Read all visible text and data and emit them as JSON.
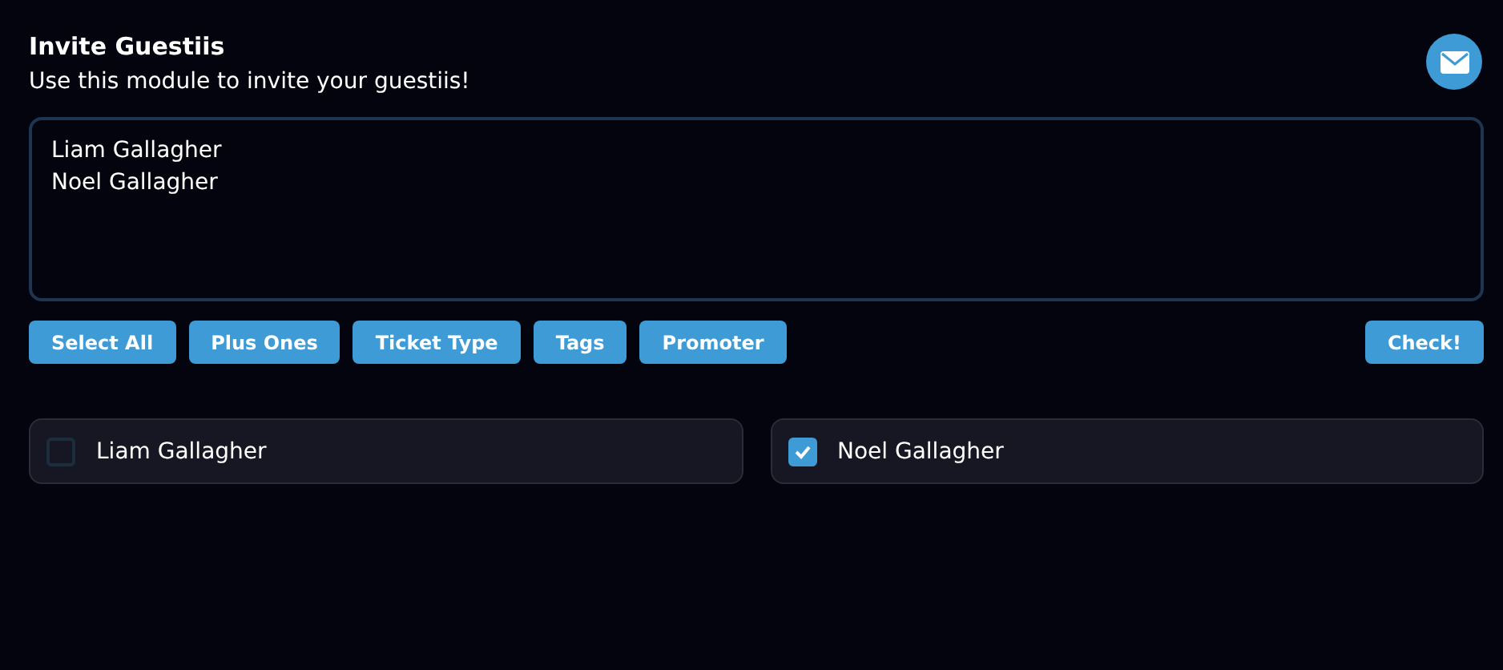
{
  "title": "Invite Guestiis",
  "subtitle": "Use this module to invite your guestiis!",
  "guest_field": {
    "lines": [
      "Liam Gallagher",
      "Noel Gallagher"
    ]
  },
  "buttons": [
    "Select All",
    "Plus Ones",
    "Ticket Type",
    "Tags",
    "Promoter"
  ],
  "check_button": "Check!",
  "guests": [
    {
      "name": "Liam Gallagher",
      "checked": false
    },
    {
      "name": "Noel Gallagher",
      "checked": true
    }
  ]
}
